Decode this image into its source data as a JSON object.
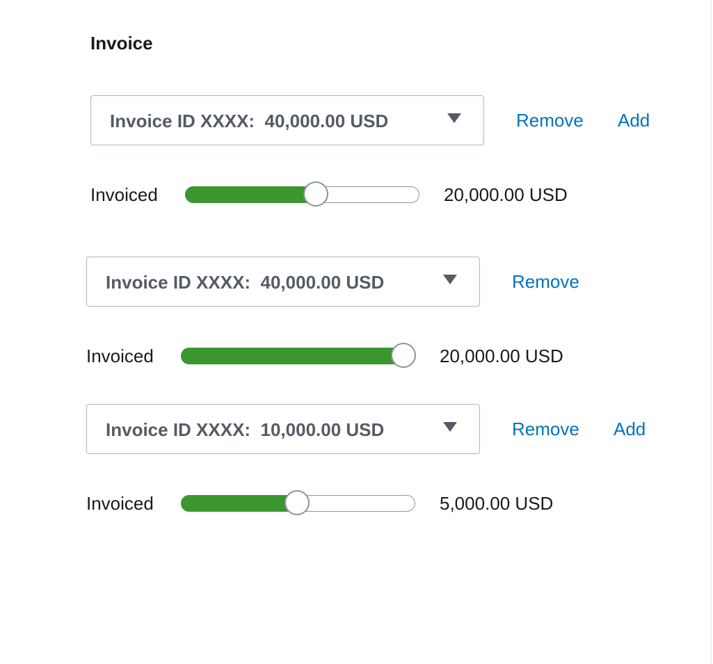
{
  "section": {
    "title": "Invoice"
  },
  "invoices": [
    {
      "select_label": "Invoice ID XXXX:  40,000.00 USD",
      "remove_label": "Remove",
      "add_label": "Add",
      "slider_label": "Invoiced",
      "invoiced_fraction": 0.57,
      "amount": "20,000.00 USD"
    },
    {
      "select_label": "Invoice ID XXXX:  40,000.00 USD",
      "remove_label": "Remove",
      "slider_label": "Invoiced",
      "invoiced_fraction": 1.0,
      "amount": "20,000.00 USD"
    },
    {
      "select_label": "Invoice ID XXXX:  10,000.00 USD",
      "remove_label": "Remove",
      "add_label": "Add",
      "slider_label": "Invoiced",
      "invoiced_fraction": 0.5,
      "amount": "5,000.00 USD"
    }
  ],
  "icons": {
    "dropdown": "caret-down-icon"
  },
  "colors": {
    "link": "#0073bb",
    "slider_fill": "#3c962f",
    "select_text": "#545b64",
    "border": "#aab7b8"
  }
}
